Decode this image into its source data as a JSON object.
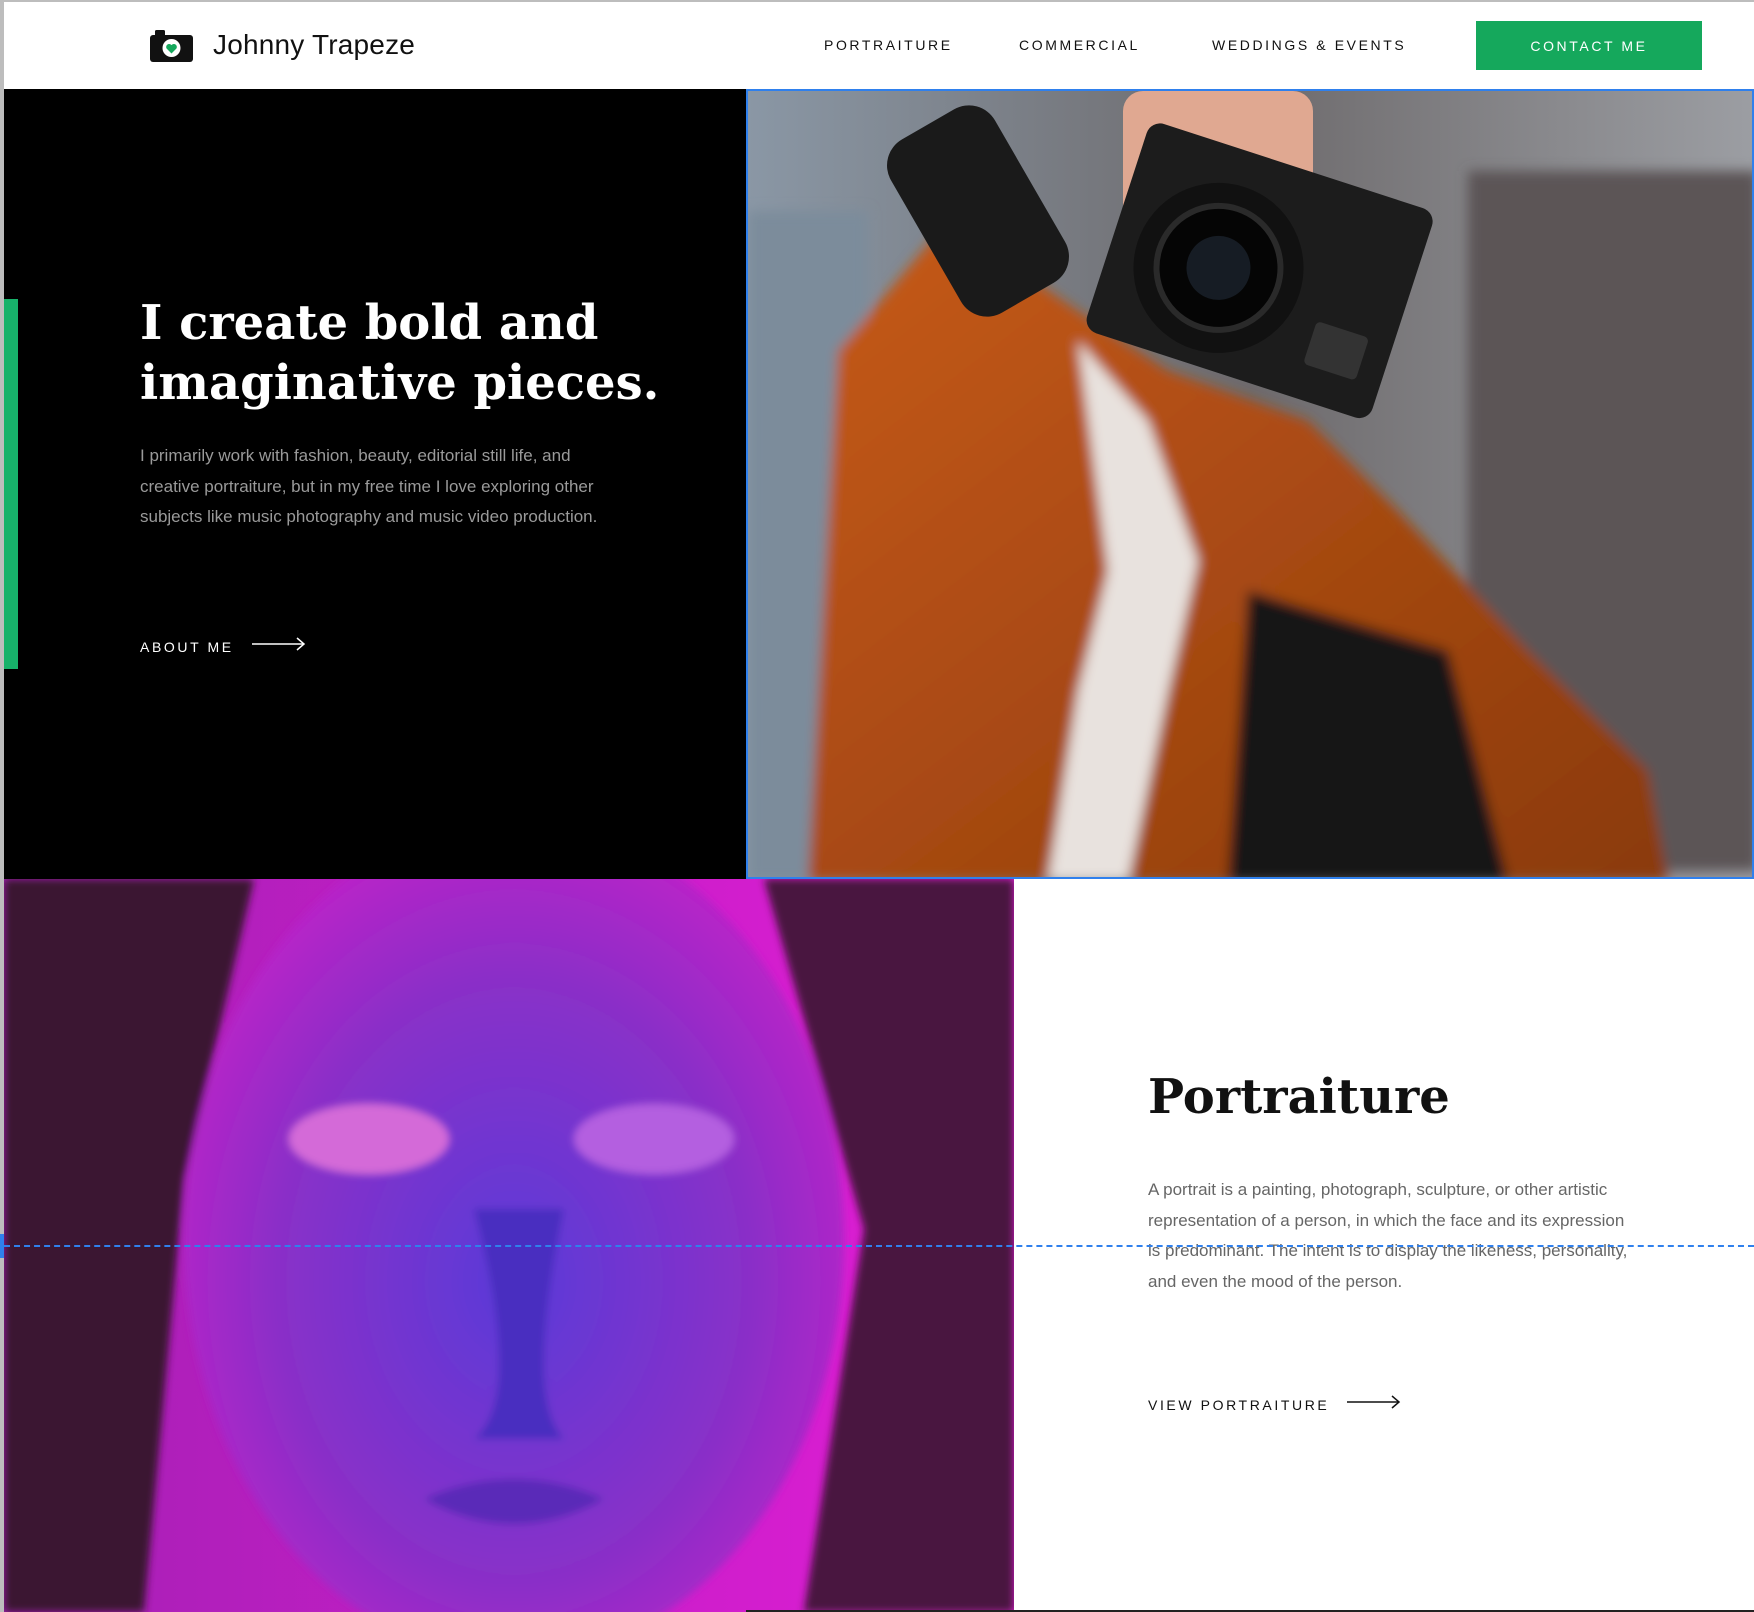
{
  "brand": {
    "name": "Johnny Trapeze",
    "icon": "camera-heart-icon",
    "accent_color": "#15a85c"
  },
  "nav": {
    "items": [
      {
        "label": "PORTRAITURE"
      },
      {
        "label": "COMMERCIAL"
      },
      {
        "label": "WEDDINGS & EVENTS"
      }
    ],
    "cta_label": "CONTACT ME"
  },
  "hero": {
    "title": "I create bold and imaginative pieces.",
    "body": "I primarily work with fashion, beauty, editorial still life, and creative portraiture, but in my free time I love exploring other subjects like music photography and music video production.",
    "link_label": "ABOUT ME",
    "image": "photographer-with-camera"
  },
  "portraiture": {
    "title": "Portraiture",
    "body": "A portrait is a painting, photograph, sculpture, or other artistic representation of a person, in which the face and its expression is predominant. The intent is to display the likeness, personality, and even the mood of the person.",
    "link_label": "VIEW PORTRAITURE",
    "image": "neon-portrait-woman"
  },
  "colors": {
    "green": "#15a85c",
    "selection_blue": "#2f80ed",
    "hero_bg": "#000000"
  }
}
